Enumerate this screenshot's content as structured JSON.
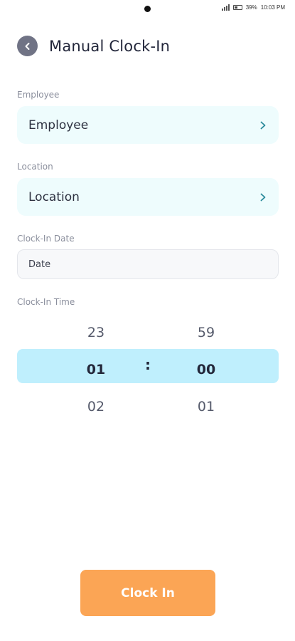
{
  "status_bar": {
    "battery": "39%",
    "time": "10:03 PM"
  },
  "header": {
    "title": "Manual Clock-In",
    "back_icon": "chevron-left-icon"
  },
  "employee": {
    "label": "Employee",
    "value": "Employee",
    "icon": "chevron-right-icon"
  },
  "location": {
    "label": "Location",
    "value": "Location",
    "icon": "chevron-right-icon"
  },
  "clock_in_date": {
    "label": "Clock-In Date",
    "placeholder": "Date"
  },
  "clock_in_time": {
    "label": "Clock-In Time",
    "hours": {
      "above": "23",
      "selected": "01",
      "below": "02"
    },
    "separator": ":",
    "minutes": {
      "above": "59",
      "selected": "00",
      "below": "01"
    }
  },
  "actions": {
    "clock_in_label": "Clock In"
  },
  "colors": {
    "accent": "#fba555",
    "field_background": "#eefcfd",
    "picker_highlight": "#bfeffd",
    "chevron": "#2a8a9b"
  }
}
